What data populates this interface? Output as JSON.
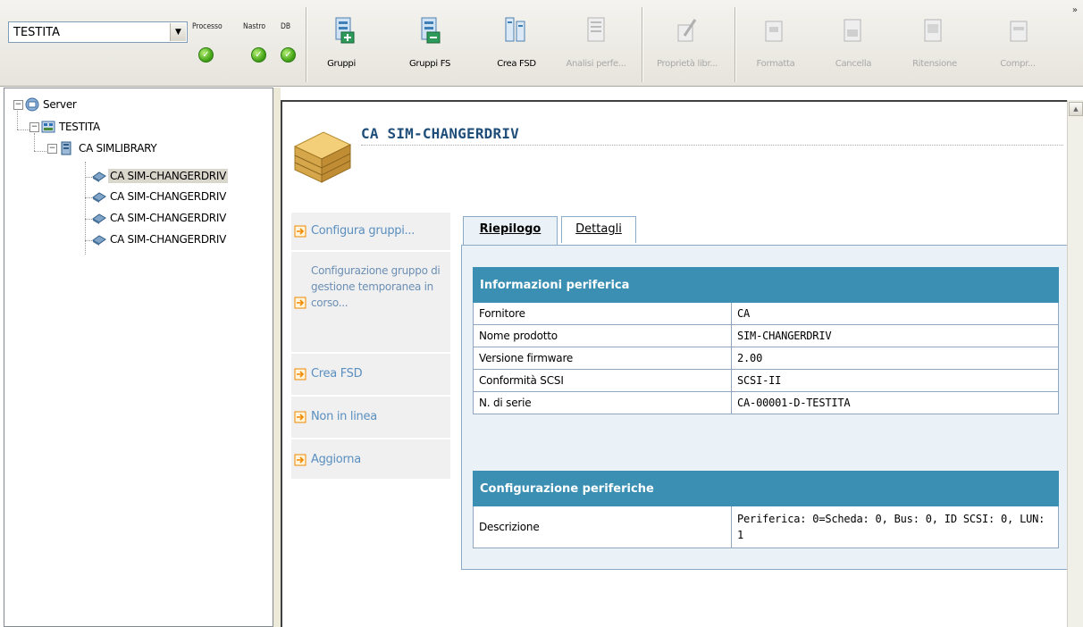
{
  "toolbar": {
    "server_select": {
      "value": "TESTITA"
    },
    "status": [
      {
        "label": "Processo",
        "color": "#3aa318"
      },
      {
        "label": "Nastro",
        "color": "#3aa318"
      },
      {
        "label": "DB",
        "color": "#3aa318"
      }
    ],
    "buttons": [
      {
        "label": "Gruppi",
        "icon": "groups-icon",
        "enabled": true
      },
      {
        "label": "Gruppi FS",
        "icon": "fs-groups-icon",
        "enabled": true
      },
      {
        "label": "Crea FSD",
        "icon": "create-fsd-icon",
        "enabled": true
      },
      {
        "label": "Analisi perfe...",
        "icon": "performance-analysis-icon",
        "enabled": false
      },
      {
        "label": "Proprietà libr...",
        "icon": "library-properties-icon",
        "enabled": false
      },
      {
        "label": "Formatta",
        "icon": "format-icon",
        "enabled": false
      },
      {
        "label": "Cancella",
        "icon": "erase-icon",
        "enabled": false
      },
      {
        "label": "Ritensione",
        "icon": "retension-icon",
        "enabled": false
      },
      {
        "label": "Compr...",
        "icon": "compression-icon",
        "enabled": false
      }
    ],
    "more": "»"
  },
  "tree": {
    "root": "Server",
    "server": "TESTITA",
    "library": "CA SIMLIBRARY",
    "drives": [
      "CA SIM-CHANGERDRIV",
      "CA SIM-CHANGERDRIV",
      "CA SIM-CHANGERDRIV",
      "CA SIM-CHANGERDRIV"
    ]
  },
  "device": {
    "title": "CA SIM-CHANGERDRIV"
  },
  "actions": [
    "Configura gruppi...",
    "Configurazione gruppo di gestione temporanea in corso...",
    "Crea FSD",
    "Non in linea",
    "Aggiorna"
  ],
  "tabs": {
    "summary": "Riepilogo",
    "details": "Dettagli"
  },
  "device_info": {
    "header": "Informazioni periferica",
    "rows": [
      {
        "label": "Fornitore",
        "value": "CA"
      },
      {
        "label": "Nome prodotto",
        "value": "SIM-CHANGERDRIV"
      },
      {
        "label": "Versione firmware",
        "value": "2.00"
      },
      {
        "label": "Conformità SCSI",
        "value": "SCSI-II"
      },
      {
        "label": "N. di serie",
        "value": "CA-00001-D-TESTITA"
      }
    ]
  },
  "device_config": {
    "header": "Configurazione periferiche",
    "rows": [
      {
        "label": "Descrizione",
        "value": "Periferica: 0=Scheda: 0, Bus: 0, ID SCSI: 0, LUN: 1"
      }
    ]
  }
}
